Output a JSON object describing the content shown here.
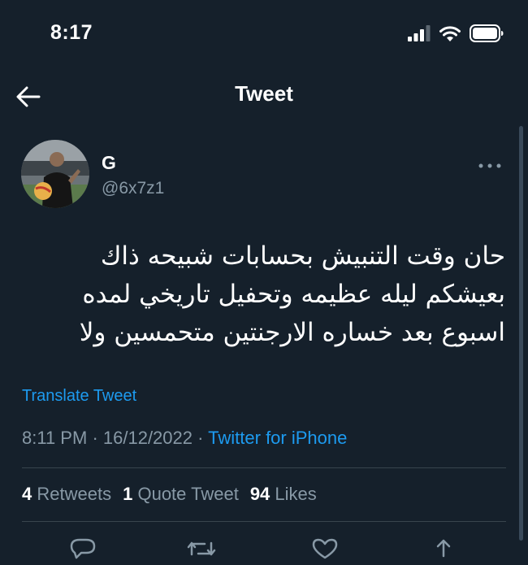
{
  "status_bar": {
    "time": "8:17",
    "icons": [
      "cellular-signal-icon",
      "wifi-icon",
      "battery-icon"
    ]
  },
  "nav": {
    "back_icon": "arrow-left-icon",
    "title": "Tweet"
  },
  "tweet": {
    "author": {
      "name": "G",
      "handle": "@6x7z1"
    },
    "text_lines": [
      "حان وقت التنبيش بحسابات شبيحه ذاك",
      "بعيشكم ليله عظيمه وتحفيل تاريخي  لمده",
      "اسبوع بعد خساره الارجنتين متحمسين ولا"
    ],
    "translate_label": "Translate Tweet",
    "time": "8:11 PM",
    "date": "16/12/2022",
    "separator": "·",
    "source": "Twitter for iPhone",
    "stats": {
      "retweets_count": "4",
      "retweets_label": "Retweets",
      "quotes_count": "1",
      "quotes_label": "Quote Tweet",
      "likes_count": "94",
      "likes_label": "Likes"
    }
  },
  "colors": {
    "background": "#15202b",
    "accent": "#1d9bf0",
    "secondary_text": "#8899a6",
    "divider": "#38444d"
  },
  "action_icons": [
    "reply-icon",
    "retweet-icon",
    "like-icon",
    "share-icon"
  ]
}
